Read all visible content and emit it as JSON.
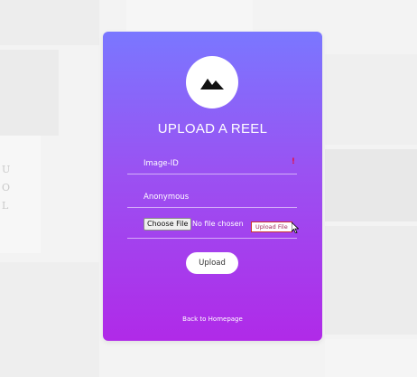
{
  "background": {
    "letters": [
      "U",
      "O",
      "L"
    ]
  },
  "card": {
    "logo_icon": "mountain-image-icon",
    "title": "UPLOAD A REEL",
    "image_id_field": {
      "placeholder": "Image-ID",
      "value": ""
    },
    "alert_icon": "!",
    "name_field": {
      "placeholder": "Anonymous",
      "value": ""
    },
    "file_input": {
      "button_label": "Choose File",
      "status_text": "No file chosen",
      "tooltip": "Upload File"
    },
    "upload_button": "Upload",
    "back_link": "Back to Homepage"
  },
  "colors": {
    "gradient_top": "#7a77ff",
    "gradient_bottom": "#b02ae8",
    "alert": "#e0124a"
  }
}
